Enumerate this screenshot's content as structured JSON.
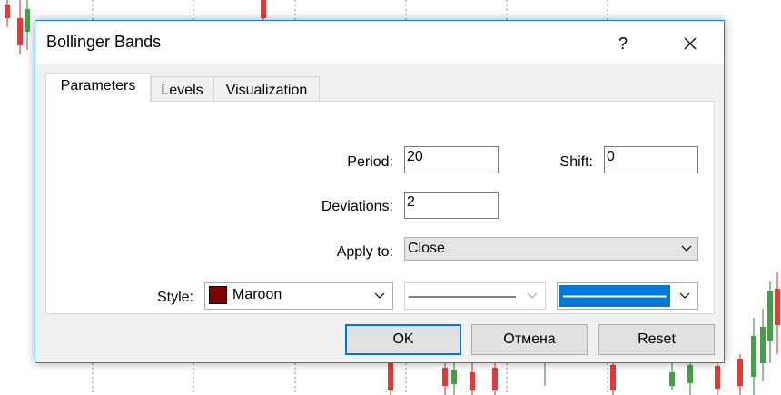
{
  "dialog": {
    "title": "Bollinger Bands",
    "help_label": "?"
  },
  "tabs": [
    {
      "label": "Parameters",
      "active": true
    },
    {
      "label": "Levels",
      "active": false
    },
    {
      "label": "Visualization",
      "active": false
    }
  ],
  "params": {
    "period_label": "Period:",
    "period_value": "20",
    "shift_label": "Shift:",
    "shift_value": "0",
    "deviations_label": "Deviations:",
    "deviations_value": "2",
    "apply_label": "Apply to:",
    "apply_value": "Close",
    "style_label": "Style:",
    "color_value": "Maroon",
    "color_hex": "#800000",
    "line_width_selected_color": "#0078d7"
  },
  "buttons": {
    "ok": "OK",
    "cancel": "Отмена",
    "reset": "Reset"
  },
  "icons": [
    "close-icon",
    "chevron-down-icon"
  ]
}
